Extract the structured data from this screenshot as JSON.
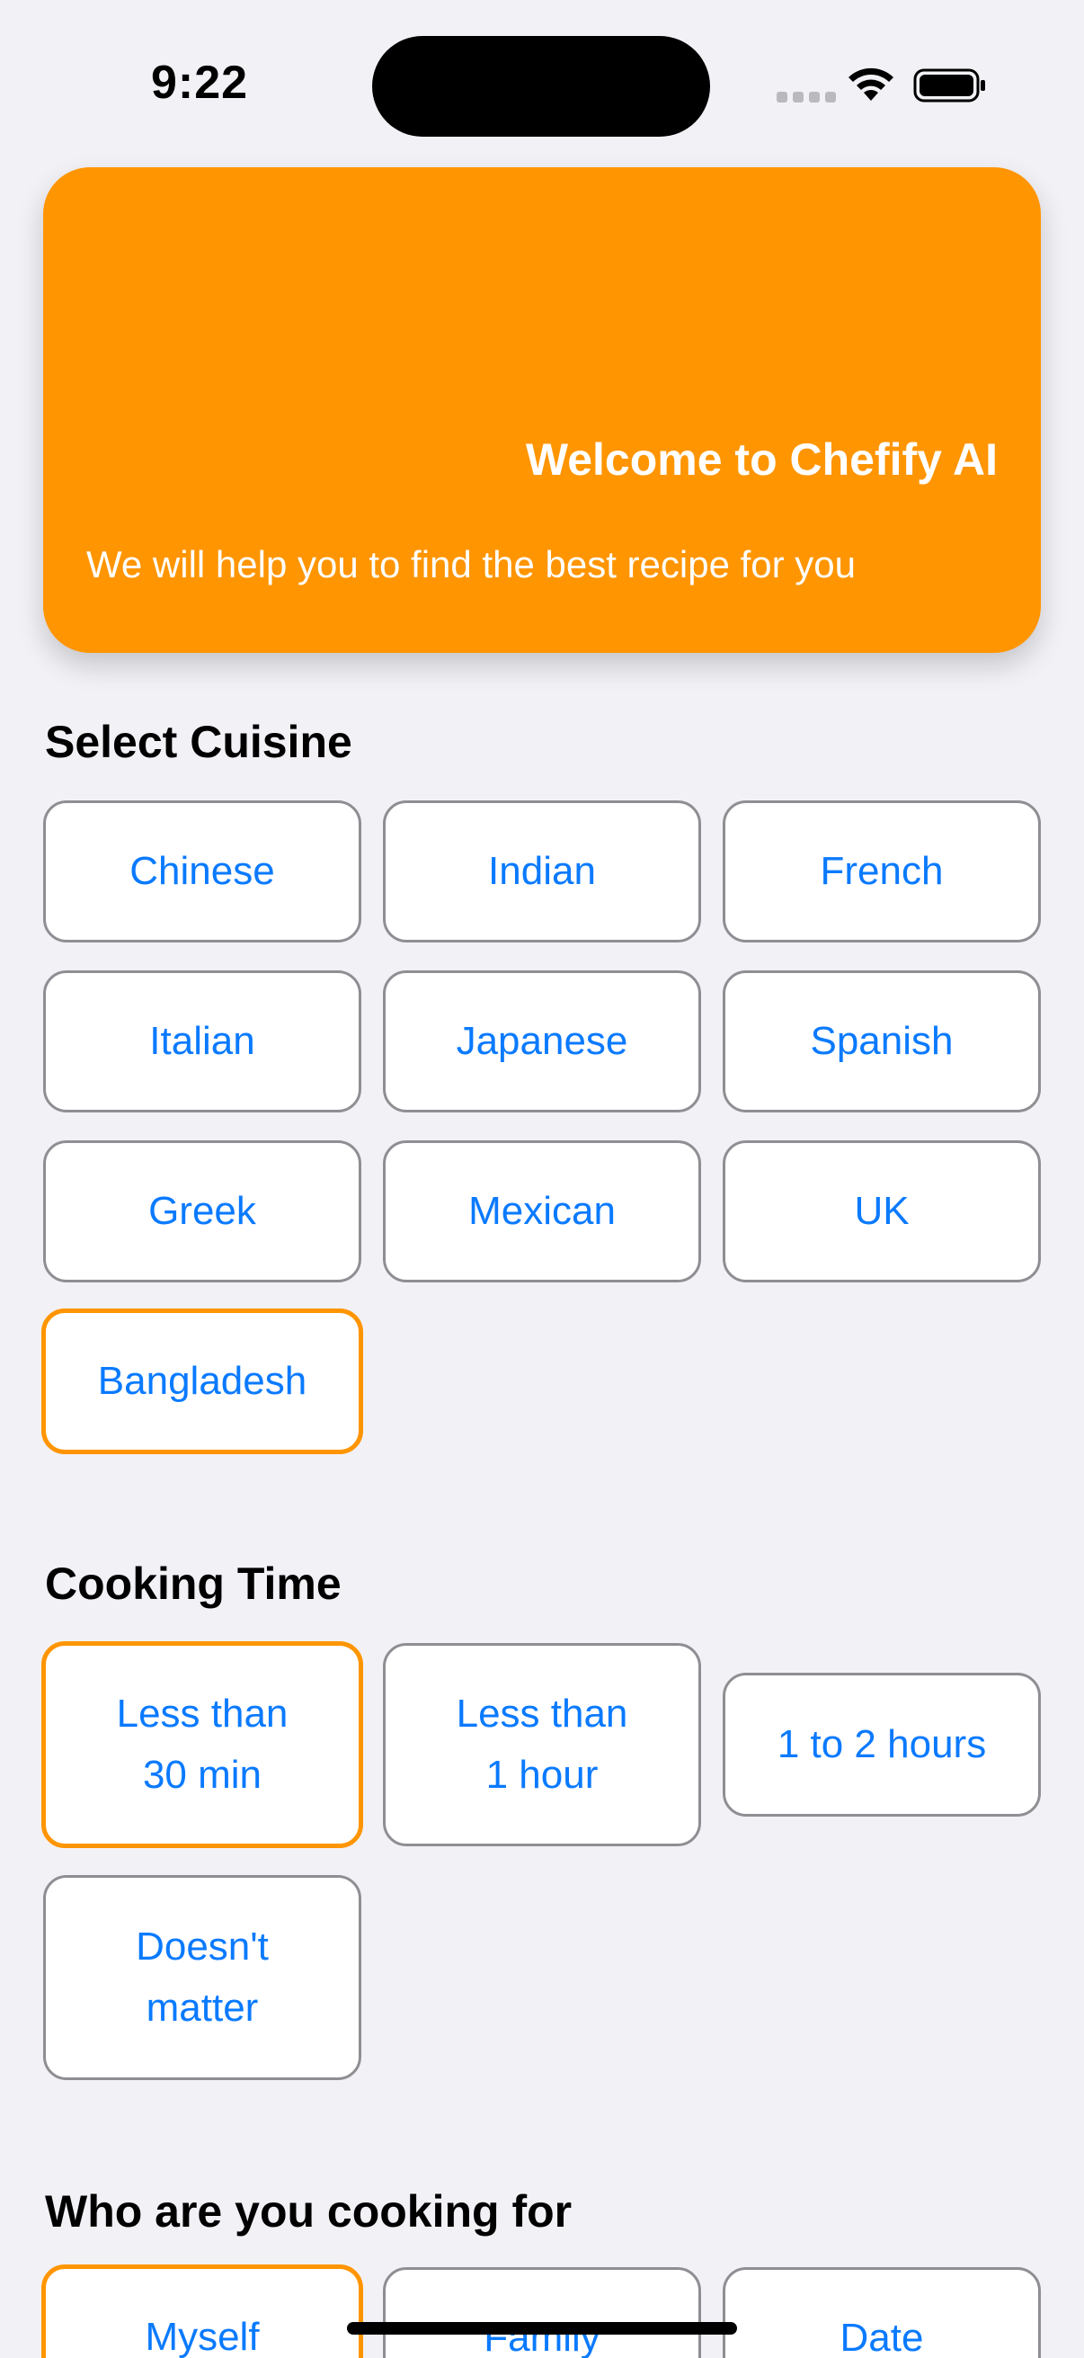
{
  "status_bar": {
    "time": "9:22"
  },
  "hero": {
    "title": "Welcome to Chefify AI",
    "subtitle": "We will help you to find the best recipe for you",
    "color": "#ff9500"
  },
  "cuisine": {
    "title": "Select Cuisine",
    "options": [
      "Chinese",
      "Indian",
      "French",
      "Italian",
      "Japanese",
      "Spanish",
      "Greek",
      "Mexican",
      "UK",
      "Bangladesh"
    ],
    "selected": "Bangladesh"
  },
  "cooking_time": {
    "title": "Cooking Time",
    "options": [
      "Less than\n30 min",
      "Less than\n1 hour",
      "1 to 2 hours",
      "Doesn't\nmatter"
    ],
    "selected": "Less than 30 min"
  },
  "audience": {
    "title": "Who are you cooking for",
    "options": [
      "Myself",
      "Family",
      "Date"
    ],
    "selected": "Myself"
  },
  "colors": {
    "accent": "#ff9500",
    "link": "#0a7aff",
    "background": "#f2f1f6",
    "border": "#8e8e93"
  }
}
